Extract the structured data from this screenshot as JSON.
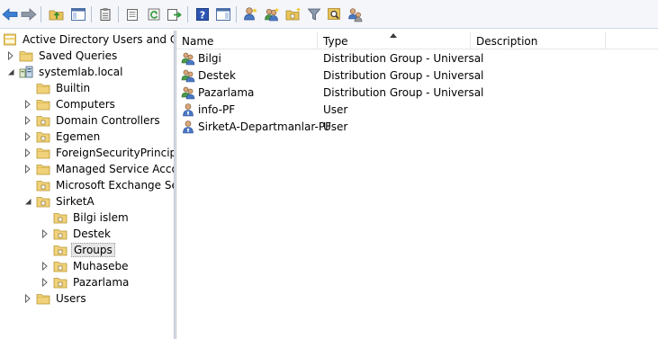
{
  "toolbar": {
    "buttons": [
      {
        "name": "back-button",
        "icon": "arrow-left-icon"
      },
      {
        "name": "forward-button",
        "icon": "arrow-right-icon"
      },
      {
        "name": "up-one-level-button",
        "icon": "folder-up-icon"
      },
      {
        "name": "show-hide-console-tree-button",
        "icon": "console-tree-icon"
      },
      {
        "name": "delete-button",
        "icon": "clipboard-icon"
      },
      {
        "name": "properties-button",
        "icon": "properties-icon"
      },
      {
        "name": "refresh-button",
        "icon": "refresh-icon"
      },
      {
        "name": "export-list-button",
        "icon": "export-icon"
      },
      {
        "name": "help-button",
        "icon": "help-icon"
      },
      {
        "name": "show-action-pane-button",
        "icon": "action-pane-icon"
      },
      {
        "name": "create-user-button",
        "icon": "new-user-icon"
      },
      {
        "name": "create-group-button",
        "icon": "new-group-icon"
      },
      {
        "name": "create-ou-button",
        "icon": "new-ou-icon"
      },
      {
        "name": "filter-button",
        "icon": "filter-icon"
      },
      {
        "name": "find-button",
        "icon": "find-icon"
      },
      {
        "name": "add-to-group-button",
        "icon": "add-to-group-icon"
      }
    ]
  },
  "tree": {
    "items": [
      {
        "label": "Active Directory Users and Com",
        "level": 0,
        "expander": "none",
        "icon": "ad-root",
        "selected": false
      },
      {
        "label": "Saved Queries",
        "level": 1,
        "expander": "collapsed",
        "icon": "folder",
        "selected": false
      },
      {
        "label": "systemlab.local",
        "level": 1,
        "expander": "expanded",
        "icon": "domain",
        "selected": false
      },
      {
        "label": "Builtin",
        "level": 2,
        "expander": "none",
        "icon": "folder",
        "selected": false
      },
      {
        "label": "Computers",
        "level": 2,
        "expander": "collapsed",
        "icon": "folder",
        "selected": false
      },
      {
        "label": "Domain Controllers",
        "level": 2,
        "expander": "collapsed",
        "icon": "ou",
        "selected": false
      },
      {
        "label": "Egemen",
        "level": 2,
        "expander": "collapsed",
        "icon": "ou",
        "selected": false
      },
      {
        "label": "ForeignSecurityPrincipals",
        "level": 2,
        "expander": "collapsed",
        "icon": "folder",
        "selected": false
      },
      {
        "label": "Managed Service Accour",
        "level": 2,
        "expander": "collapsed",
        "icon": "folder",
        "selected": false
      },
      {
        "label": "Microsoft Exchange Secu",
        "level": 2,
        "expander": "none",
        "icon": "ou",
        "selected": false
      },
      {
        "label": "SirketA",
        "level": 2,
        "expander": "expanded",
        "icon": "ou",
        "selected": false
      },
      {
        "label": "Bilgi islem",
        "level": 3,
        "expander": "none",
        "icon": "ou",
        "selected": false
      },
      {
        "label": "Destek",
        "level": 3,
        "expander": "collapsed",
        "icon": "ou",
        "selected": false
      },
      {
        "label": "Groups",
        "level": 3,
        "expander": "none",
        "icon": "ou",
        "selected": true
      },
      {
        "label": "Muhasebe",
        "level": 3,
        "expander": "collapsed",
        "icon": "ou",
        "selected": false
      },
      {
        "label": "Pazarlama",
        "level": 3,
        "expander": "collapsed",
        "icon": "ou",
        "selected": false
      },
      {
        "label": "Users",
        "level": 2,
        "expander": "collapsed",
        "icon": "folder",
        "selected": false
      }
    ]
  },
  "list": {
    "columns": [
      "Name",
      "Type",
      "Description"
    ],
    "sorted_column": "Type",
    "rows": [
      {
        "name": "Bilgi",
        "type": "Distribution Group - Universal",
        "description": "",
        "icon": "group"
      },
      {
        "name": "Destek",
        "type": "Distribution Group - Universal",
        "description": "",
        "icon": "group"
      },
      {
        "name": "Pazarlama",
        "type": "Distribution Group - Universal",
        "description": "",
        "icon": "group"
      },
      {
        "name": "info-PF",
        "type": "User",
        "description": "",
        "icon": "user"
      },
      {
        "name": "SirketA-Departmanlar-PF",
        "type": "User",
        "description": "",
        "icon": "user"
      }
    ]
  }
}
